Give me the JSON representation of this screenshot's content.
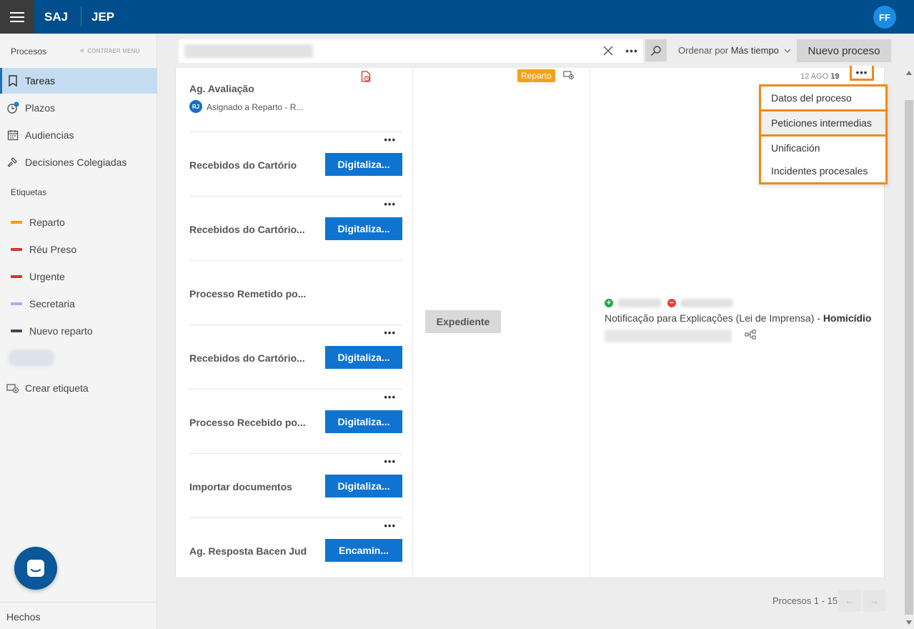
{
  "topbar": {
    "brand1": "SAJ",
    "brand2": "JEP",
    "avatar": "FF"
  },
  "sidebar": {
    "header": "Procesos",
    "collapse": "CONTRAER MENÚ",
    "items": [
      {
        "label": "Tareas",
        "icon": "bookmark-icon",
        "active": true
      },
      {
        "label": "Plazos",
        "icon": "clock-icon"
      },
      {
        "label": "Audiencias",
        "icon": "calendar-icon"
      },
      {
        "label": "Decisiones Colegiadas",
        "icon": "gavel-icon"
      }
    ],
    "tags_header": "Etiquetas",
    "tags": [
      {
        "label": "Reparto",
        "color": "#f39c12"
      },
      {
        "label": "Réu Preso",
        "color": "#d9342b"
      },
      {
        "label": "Urgente",
        "color": "#d9342b"
      },
      {
        "label": "Secretaria",
        "color": "#b9a3f5"
      },
      {
        "label": "Nuevo reparto",
        "color": "#3c4a5a"
      }
    ],
    "create_tag": "Crear etiqueta",
    "footer": "Hechos"
  },
  "toolbar": {
    "search_value": "",
    "more": "•••",
    "sort_prefix": "Ordenar por",
    "sort_value": "Más tiempo",
    "new_button": "Nuevo proceso"
  },
  "first_task": {
    "title": "Ag. Avaliação",
    "badge": "RJ",
    "assigned": "Asignado a Reparto - R..."
  },
  "tasks": [
    {
      "title": "Recebidos do Cartório",
      "action": "Digitaliza..."
    },
    {
      "title": "Recebidos do Cartório...",
      "action": "Digitaliza..."
    },
    {
      "title": "Processo Remetido po...",
      "action": ""
    },
    {
      "title": "Recebidos do Cartório...",
      "action": "Digitaliza..."
    },
    {
      "title": "Processo Recebido po...",
      "action": "Digitaliza..."
    },
    {
      "title": "Importar documentos",
      "action": "Digitaliza..."
    },
    {
      "title": "Ag. Resposta Bacen Jud",
      "action": "Encamin..."
    }
  ],
  "middle": {
    "badge": "Reparto",
    "expediente": "Expediente"
  },
  "detail": {
    "date": "12 AGO",
    "date_year": "19",
    "notification": "Notificação para Explicações (Lei de Imprensa) - ",
    "notification_bold": "Homicídio"
  },
  "dropdown": {
    "items": [
      "Datos del proceso",
      "Peticiones intermedias",
      "Unificación",
      "Incidentes procesales"
    ],
    "highlight_color": "#ef8a1b"
  },
  "pager": {
    "text": "Procesos 1 - 15",
    "prev": "←",
    "next": "→"
  }
}
